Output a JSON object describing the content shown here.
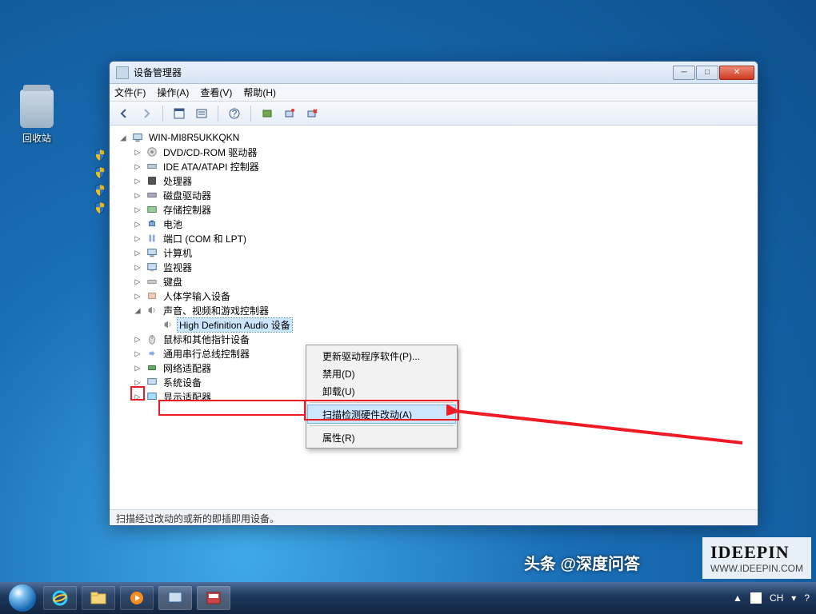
{
  "desktop": {
    "recycle_bin": "回收站"
  },
  "window": {
    "title": "设备管理器",
    "menus": {
      "file": "文件(F)",
      "action": "操作(A)",
      "view": "查看(V)",
      "help": "帮助(H)"
    },
    "status": "扫描经过改动的或新的即插即用设备。",
    "root": "WIN-MI8R5UKKQKN",
    "categories": [
      "DVD/CD-ROM 驱动器",
      "IDE ATA/ATAPI 控制器",
      "处理器",
      "磁盘驱动器",
      "存储控制器",
      "电池",
      "端口 (COM 和 LPT)",
      "计算机",
      "监视器",
      "键盘",
      "人体学输入设备",
      "声音、视频和游戏控制器",
      "鼠标和其他指针设备",
      "通用串行总线控制器",
      "网络适配器",
      "系统设备",
      "显示适配器"
    ],
    "selected_device": "High Definition Audio 设备"
  },
  "context_menu": {
    "update": "更新驱动程序软件(P)...",
    "disable": "禁用(D)",
    "uninstall": "卸载(U)",
    "scan": "扫描检测硬件改动(A)",
    "properties": "属性(R)"
  },
  "taskbar": {
    "ime": "CH",
    "watermark_brand": "IDEEPIN",
    "watermark_sub": "WWW.IDEEPIN.COM",
    "watermark_tag": "头条 @深度问答"
  }
}
